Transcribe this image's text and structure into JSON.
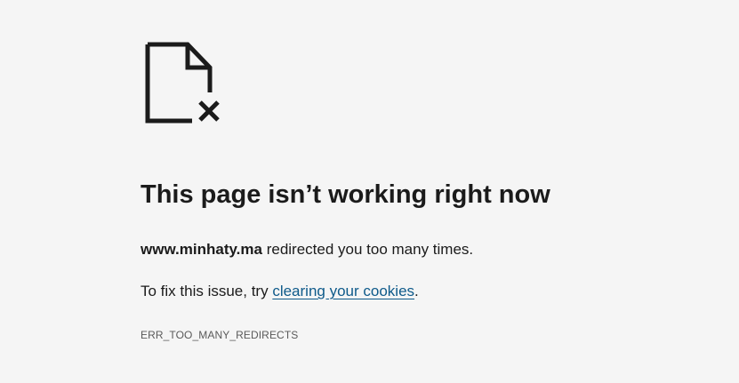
{
  "error_page": {
    "icon": "broken-document-icon",
    "title": "This page isn’t working right now",
    "message": {
      "domain": "www.minhaty.ma",
      "text": " redirected you too many times."
    },
    "fix": {
      "prefix": "To fix this issue, try ",
      "link_label": "clearing your cookies",
      "suffix": "."
    },
    "error_code": "ERR_TOO_MANY_REDIRECTS"
  },
  "colors": {
    "background": "#f5f5f5",
    "text": "#1b1b1b",
    "link": "#0e5a8a",
    "code": "#5a5a5a"
  }
}
